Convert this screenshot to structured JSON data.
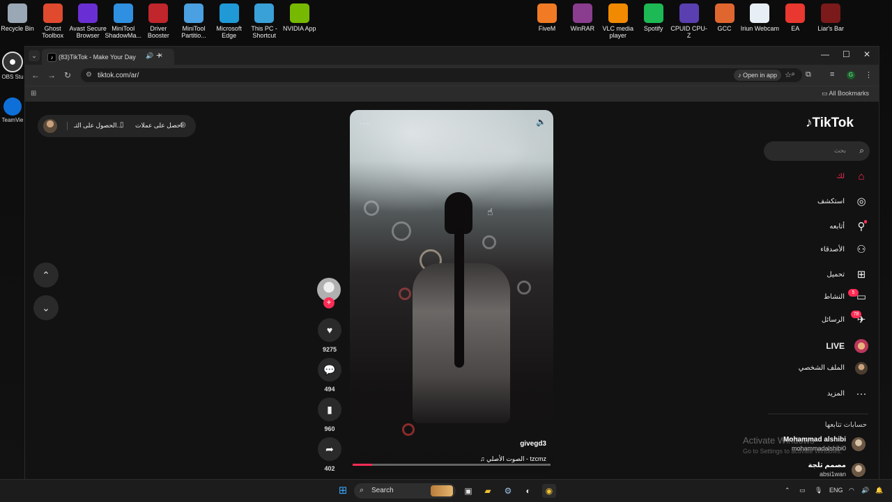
{
  "desktop": {
    "icons_left": [
      {
        "label": "Recycle Bin",
        "icon": "recycle-bin-icon",
        "color": "#9aa7b4"
      },
      {
        "label": "Ghost Toolbox",
        "icon": "ghost-toolbox-icon",
        "color": "#e04a2f"
      },
      {
        "label": "Avast Secure Browser",
        "icon": "avast-browser-icon",
        "color": "#6a2fd4"
      },
      {
        "label": "MiniTool ShadowMa...",
        "icon": "minitool-shadowmaker-icon",
        "color": "#2f8fe0"
      },
      {
        "label": "Driver Booster",
        "icon": "driver-booster-icon",
        "color": "#c0262c"
      },
      {
        "label": "MiniTool Partitio...",
        "icon": "minitool-partition-icon",
        "color": "#4aa0e0"
      },
      {
        "label": "Microsoft Edge",
        "icon": "edge-icon",
        "color": "#1f9ad6"
      },
      {
        "label": "This PC - Shortcut",
        "icon": "this-pc-icon",
        "color": "#3aa0d8"
      },
      {
        "label": "NVIDIA App",
        "icon": "nvidia-icon",
        "color": "#76b900"
      }
    ],
    "icons_right": [
      {
        "label": "FiveM",
        "icon": "fivem-icon",
        "color": "#f07b24"
      },
      {
        "label": "WinRAR",
        "icon": "winrar-icon",
        "color": "#8a3d8f"
      },
      {
        "label": "VLC media player",
        "icon": "vlc-icon",
        "color": "#f18a00"
      },
      {
        "label": "Spotify",
        "icon": "spotify-icon",
        "color": "#1db954"
      },
      {
        "label": "CPUID CPU-Z",
        "icon": "cpuz-icon",
        "color": "#5a3fb0"
      },
      {
        "label": "GCC",
        "icon": "gcc-icon",
        "color": "#e0662f"
      },
      {
        "label": "Iriun Webcam",
        "icon": "iriun-webcam-icon",
        "color": "#e8eef5"
      },
      {
        "label": "EA",
        "icon": "ea-icon",
        "color": "#e8382f"
      },
      {
        "label": "Liar's Bar",
        "icon": "liars-bar-icon",
        "color": "#7a1a1a"
      }
    ],
    "side_icons": [
      {
        "label": "OBS Stu",
        "icon": "obs-icon"
      },
      {
        "label": "TeamVie",
        "icon": "teamviewer-icon"
      }
    ],
    "watermark_title": "Activate Windows",
    "watermark_sub": "Go to Settings to activate Windows."
  },
  "browser": {
    "tab_title": "(83)TikTok - Make Your Day",
    "url": "tiktok.com/ar/",
    "open_in_app": "Open in app",
    "all_bookmarks": "All Bookmarks",
    "profile_initial": "G"
  },
  "page": {
    "promo": {
      "get_app": "الحصول على التـ...",
      "get_coins": "احصل على عملات"
    },
    "logo": "TikTok",
    "search_placeholder": "بحث",
    "nav": [
      {
        "label": "لك",
        "icon": "home-icon",
        "active": true
      },
      {
        "label": "استكشف",
        "icon": "compass-icon"
      },
      {
        "label": "أتابعه",
        "icon": "following-icon"
      },
      {
        "label": "الأصدقاء",
        "icon": "friends-icon"
      },
      {
        "label": "تحميل",
        "icon": "upload-icon"
      },
      {
        "label": "النشاط",
        "icon": "activity-icon",
        "badge": "5"
      },
      {
        "label": "الرسائل",
        "icon": "messages-icon",
        "badge": "78"
      },
      {
        "label": "LIVE",
        "icon": "live-icon"
      },
      {
        "label": "الملف الشخصي",
        "icon": "profile-icon"
      },
      {
        "label": "المزيد",
        "icon": "more-icon"
      }
    ],
    "following_header": "حسابات تتابعها",
    "following": [
      {
        "name": "Mohammad alshibi",
        "username": "mohammadalshibi0"
      },
      {
        "name": "مصمم ثلجة",
        "username": "absi1wan"
      }
    ],
    "video": {
      "username": "givegd3",
      "music": "الصوت الأصلي - tzcmz",
      "progress": 0.1
    },
    "actions": {
      "likes": "9275",
      "comments": "494",
      "saves": "960",
      "shares": "402"
    }
  },
  "taskbar": {
    "search": "Search",
    "lang": "ENG"
  },
  "colors": {
    "accent": "#fe2c55"
  }
}
